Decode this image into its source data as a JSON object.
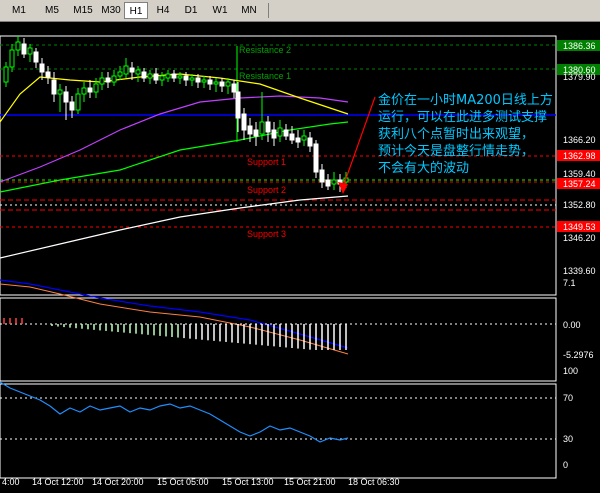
{
  "toolbar": {
    "timeframes": [
      "M1",
      "M5",
      "M15",
      "M30",
      "H1",
      "H4",
      "D1",
      "W1",
      "MN"
    ],
    "active": "H1"
  },
  "chart": {
    "levels": {
      "resistance2": "Resistance 2",
      "resistance1": "Resistance 1",
      "support1": "Support 1",
      "support2": "Support 2",
      "support3": "Support 3"
    },
    "price_tags": {
      "p1386": "1386.36",
      "p1380": "1380.60",
      "p1366red": "1362.98",
      "p1357": "1357.24",
      "p1349": "1349.53"
    },
    "price_axis": [
      "1379.90",
      "1366.20",
      "1359.40",
      "1352.80",
      "1346.20",
      "1339.60"
    ],
    "annotation": [
      "金价在一小时MA200日线上方",
      "运行，可以在此进多测试支撑",
      "获利八个点暂时出来观望，",
      "预计今天是盘整行情走势，",
      "不会有大的波动"
    ],
    "macd_axis": [
      "7.1",
      "0.00",
      "-5.2976"
    ],
    "rsi_axis": [
      "100",
      "70",
      "30",
      "0"
    ],
    "time_axis": [
      "4:00",
      "14 Oct 12:00",
      "14 Oct 20:00",
      "15 Oct 05:00",
      "15 Oct 13:00",
      "15 Oct 21:00",
      "18 Oct 06:30"
    ]
  },
  "colors": {
    "bull": "#00ff00",
    "bear": "#ffffff",
    "ma_short": "#ffff00",
    "ma_mid": "#00ff00",
    "ma_long": "#c040ff",
    "ma200": "#ffffff",
    "blue_line": "#0000ff",
    "resistance": "#008000",
    "support": "#ff0000",
    "annotation": "#00c8ff"
  }
}
